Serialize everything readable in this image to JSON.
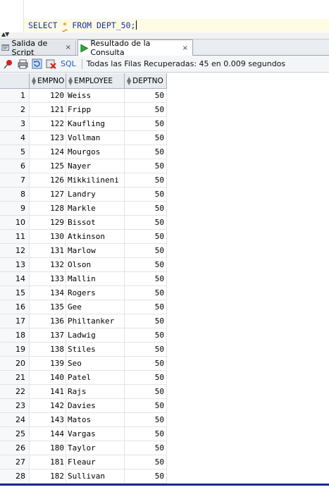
{
  "editor": {
    "kw_select": "SELECT",
    "star": "*",
    "kw_from": "FROM",
    "table": "DEPT_50;"
  },
  "tabs": [
    {
      "label": "Salida de Script",
      "close": "×",
      "icon": "script-output-icon"
    },
    {
      "label": "Resultado de la Consulta",
      "close": "×",
      "icon": "run-query-icon"
    }
  ],
  "toolbar": {
    "sql_label": "SQL",
    "status": "Todas las Filas Recuperadas: 45 en 0.009 segundos"
  },
  "grid": {
    "columns": [
      "EMPNO",
      "EMPLOYEE",
      "DEPTNO"
    ],
    "rows": [
      {
        "n": "1",
        "empno": "120",
        "employee": "Weiss",
        "deptno": "50"
      },
      {
        "n": "2",
        "empno": "121",
        "employee": "Fripp",
        "deptno": "50"
      },
      {
        "n": "3",
        "empno": "122",
        "employee": "Kaufling",
        "deptno": "50"
      },
      {
        "n": "4",
        "empno": "123",
        "employee": "Vollman",
        "deptno": "50"
      },
      {
        "n": "5",
        "empno": "124",
        "employee": "Mourgos",
        "deptno": "50"
      },
      {
        "n": "6",
        "empno": "125",
        "employee": "Nayer",
        "deptno": "50"
      },
      {
        "n": "7",
        "empno": "126",
        "employee": "Mikkilineni",
        "deptno": "50"
      },
      {
        "n": "8",
        "empno": "127",
        "employee": "Landry",
        "deptno": "50"
      },
      {
        "n": "9",
        "empno": "128",
        "employee": "Markle",
        "deptno": "50"
      },
      {
        "n": "10",
        "empno": "129",
        "employee": "Bissot",
        "deptno": "50"
      },
      {
        "n": "11",
        "empno": "130",
        "employee": "Atkinson",
        "deptno": "50"
      },
      {
        "n": "12",
        "empno": "131",
        "employee": "Marlow",
        "deptno": "50"
      },
      {
        "n": "13",
        "empno": "132",
        "employee": "Olson",
        "deptno": "50"
      },
      {
        "n": "14",
        "empno": "133",
        "employee": "Mallin",
        "deptno": "50"
      },
      {
        "n": "15",
        "empno": "134",
        "employee": "Rogers",
        "deptno": "50"
      },
      {
        "n": "16",
        "empno": "135",
        "employee": "Gee",
        "deptno": "50"
      },
      {
        "n": "17",
        "empno": "136",
        "employee": "Philtanker",
        "deptno": "50"
      },
      {
        "n": "18",
        "empno": "137",
        "employee": "Ladwig",
        "deptno": "50"
      },
      {
        "n": "19",
        "empno": "138",
        "employee": "Stiles",
        "deptno": "50"
      },
      {
        "n": "20",
        "empno": "139",
        "employee": "Seo",
        "deptno": "50"
      },
      {
        "n": "21",
        "empno": "140",
        "employee": "Patel",
        "deptno": "50"
      },
      {
        "n": "22",
        "empno": "141",
        "employee": "Rajs",
        "deptno": "50"
      },
      {
        "n": "23",
        "empno": "142",
        "employee": "Davies",
        "deptno": "50"
      },
      {
        "n": "24",
        "empno": "143",
        "employee": "Matos",
        "deptno": "50"
      },
      {
        "n": "25",
        "empno": "144",
        "employee": "Vargas",
        "deptno": "50"
      },
      {
        "n": "26",
        "empno": "180",
        "employee": "Taylor",
        "deptno": "50"
      },
      {
        "n": "27",
        "empno": "181",
        "employee": "Fleaur",
        "deptno": "50"
      },
      {
        "n": "28",
        "empno": "182",
        "employee": "Sullivan",
        "deptno": "50"
      }
    ]
  }
}
